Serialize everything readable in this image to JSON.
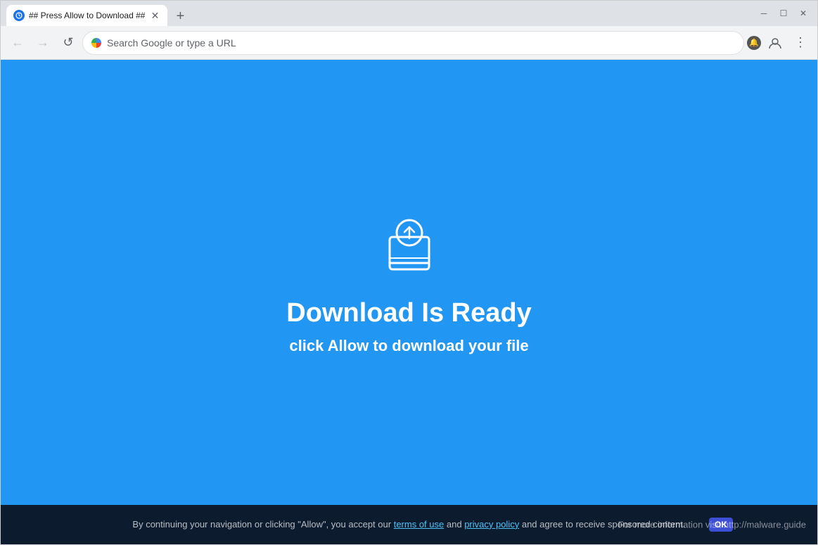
{
  "window": {
    "title": "## Press Allow to Download ##",
    "tab": {
      "label": "## Press Allow to Download ##",
      "favicon_color": "#1a73e8"
    }
  },
  "titlebar": {
    "close_label": "✕",
    "maximize_label": "☐",
    "minimize_label": "─",
    "new_tab_label": "+"
  },
  "navbar": {
    "back_label": "←",
    "forward_label": "→",
    "reload_label": "↺",
    "address_placeholder": "Search Google or type a URL",
    "address_value": "Search Google or type a URL",
    "menu_label": "⋮",
    "profile_label": "👤"
  },
  "page": {
    "main_title": "Download Is Ready",
    "sub_title": "click Allow to download your file",
    "icon_label": "download-book-icon"
  },
  "bottom_bar": {
    "text_part1": "By continuing your navigation or clicking \"Allow\", you accept our",
    "terms_label": "terms of use",
    "text_part2": "and",
    "privacy_label": "privacy policy",
    "text_part3": "and agree to receive sponsored content.",
    "watermark": "For more information visit http://malware.guide",
    "ok_badge": "OK"
  }
}
